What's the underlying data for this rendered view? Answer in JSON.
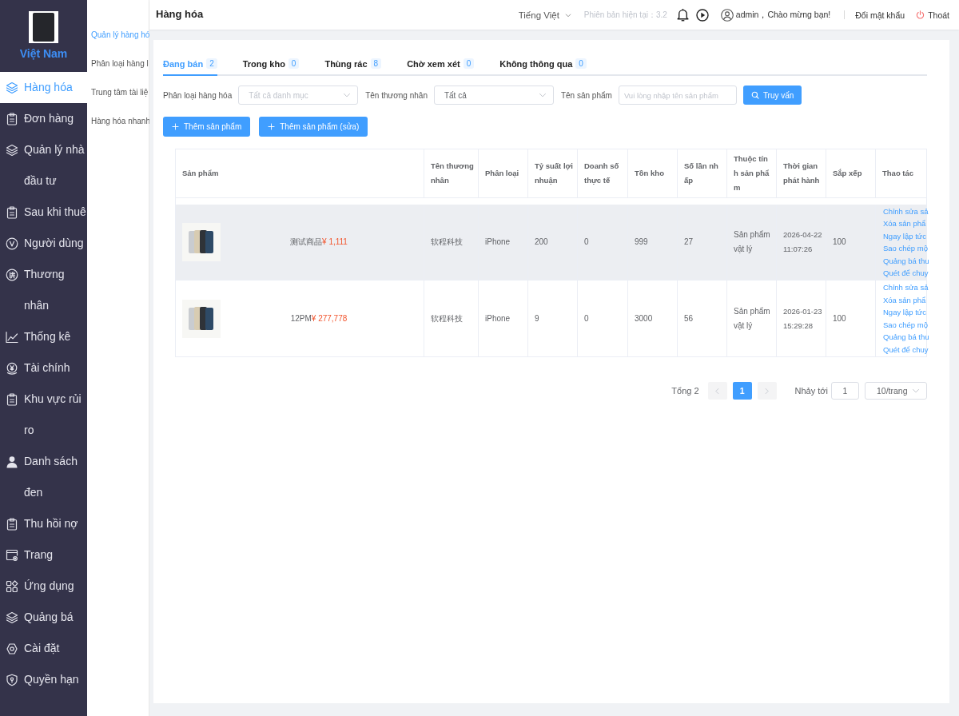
{
  "sidebar": {
    "brand": "Việt Nam",
    "items": [
      {
        "label": "Hàng hóa",
        "selected": true
      },
      {
        "label": "Đơn hàng",
        "selected": false
      },
      {
        "label": "Quản lý nhà đầu tư",
        "selected": false
      },
      {
        "label": "Sau khi thuê",
        "selected": false
      },
      {
        "label": "Người dùng",
        "selected": false
      },
      {
        "label": "Thương nhân",
        "selected": false
      },
      {
        "label": "Thống kê",
        "selected": false
      },
      {
        "label": "Tài chính",
        "selected": false
      },
      {
        "label": "Khu vực rủi ro",
        "selected": false
      },
      {
        "label": "Danh sách đen",
        "selected": false
      },
      {
        "label": "Thu hồi nợ",
        "selected": false
      },
      {
        "label": "Trang",
        "selected": false
      },
      {
        "label": "Ứng dụng",
        "selected": false
      },
      {
        "label": "Quảng bá",
        "selected": false
      },
      {
        "label": "Cài đặt",
        "selected": false
      },
      {
        "label": "Quyền hạn",
        "selected": false
      }
    ]
  },
  "submenu": {
    "items": [
      {
        "label": "Quản lý hàng hó",
        "selected": true
      },
      {
        "label": "Phân loại hàng l",
        "selected": false
      },
      {
        "label": "Trung tâm tài liệ",
        "selected": false
      },
      {
        "label": "Hàng hóa nhanh",
        "selected": false
      }
    ]
  },
  "topbar": {
    "title": "Hàng hóa",
    "language": "Tiếng Việt",
    "version": "Phiên bản hiện tại：3.2",
    "greeting": "admin，Chào mừng bạn!",
    "change_password": "Đổi mật khẩu",
    "logout": "Thoát"
  },
  "tabs": [
    {
      "label": "Đang bán",
      "count": "2",
      "selected": true
    },
    {
      "label": "Trong kho",
      "count": "0",
      "selected": false
    },
    {
      "label": "Thùng rác",
      "count": "8",
      "selected": false
    },
    {
      "label": "Chờ xem xét",
      "count": "0",
      "selected": false
    },
    {
      "label": "Không thông qua",
      "count": "0",
      "selected": false
    }
  ],
  "filters": [
    {
      "label": "Phân loại hàng hóa",
      "kind": "select",
      "placeholder": "Tất cả danh mục"
    },
    {
      "label": "Tên thương nhân",
      "kind": "select",
      "value": "Tất cả"
    },
    {
      "label": "Tên sản phẩm",
      "kind": "input",
      "placeholder": "Vui lòng nhập tên sản phẩm"
    }
  ],
  "search_button": {
    "label": "Truy vấn"
  },
  "add_buttons": [
    {
      "label": "Thêm sản phẩm"
    },
    {
      "label": "Thêm sản phẩm (sửa)"
    }
  ],
  "table": {
    "columns": [
      "Sản phẩm",
      "Tên thương nhân",
      "Phân loại",
      "Tỷ suất lợi nhuận",
      "Doanh số thực tế",
      "Tồn kho",
      "Số lần nhấp",
      "Thuộc tính sản phẩm",
      "Thời gian phát hành",
      "Sắp xếp",
      "Thao tác"
    ],
    "rows": [
      {
        "highlighted": true,
        "product_name": "测试商品",
        "price": "¥ 1,111",
        "merchant": "软程科技",
        "category": "iPhone",
        "profit_rate": "200",
        "actual_sales": "0",
        "stock": "999",
        "clicks": "27",
        "attribute": "Sản phẩm vật lý",
        "release_time": "2026-04-22 11:07:26",
        "sort": "100",
        "actions": [
          "Chỉnh sửa sả",
          "Xóa sản phẩ",
          "Ngay lập tức",
          "Sao chép mộ",
          "Quảng bá thu",
          "Quét để chuy"
        ]
      },
      {
        "highlighted": false,
        "product_name": "12PM",
        "price": "¥ 277,778",
        "merchant": "软程科技",
        "category": "iPhone",
        "profit_rate": "9",
        "actual_sales": "0",
        "stock": "3000",
        "clicks": "56",
        "attribute": "Sản phẩm vật lý",
        "release_time": "2026-01-23 15:29:28",
        "sort": "100",
        "actions": [
          "Chỉnh sửa sả",
          "Xóa sản phẩ",
          "Ngay lập tức",
          "Sao chép mộ",
          "Quảng bá thu",
          "Quét để chuy"
        ]
      }
    ]
  },
  "pagination": {
    "total": "Tổng 2",
    "prev": {
      "disabled": true
    },
    "pages": [
      {
        "label": "1",
        "selected": true
      }
    ],
    "next": {
      "disabled": true
    },
    "jump_label": "Nhảy tới",
    "jump_value": "1",
    "page_size": "10/trang"
  }
}
